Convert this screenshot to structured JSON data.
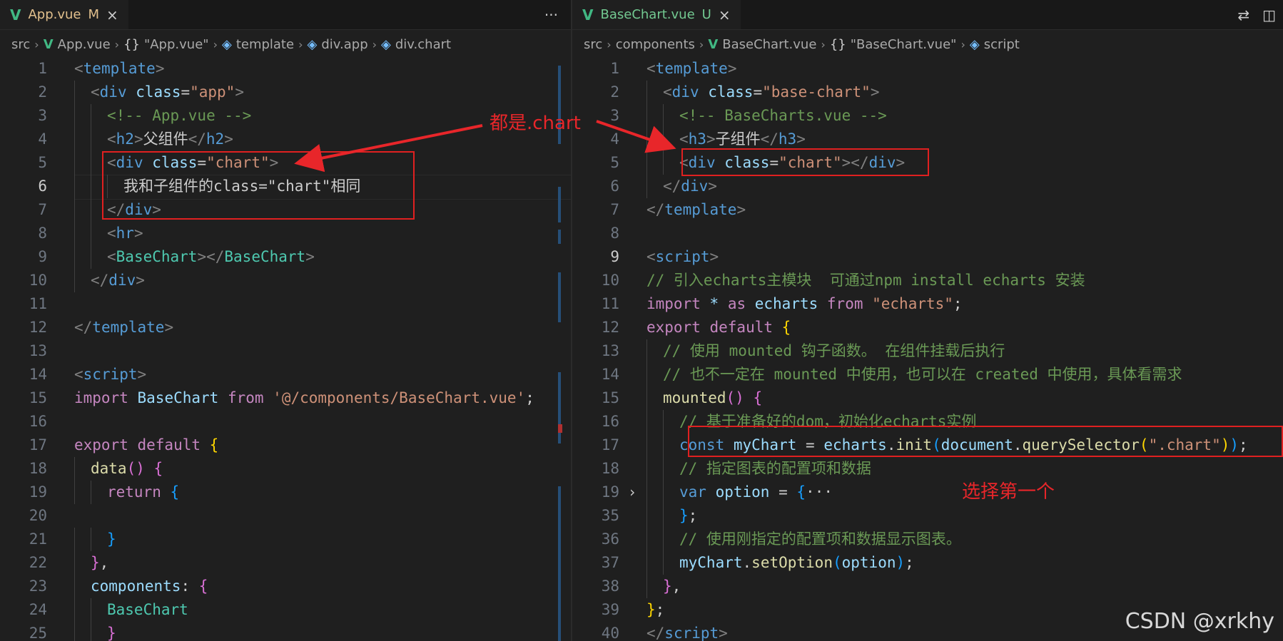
{
  "left": {
    "tab": {
      "name": "App.vue",
      "status": "M",
      "close": "×"
    },
    "more": "···",
    "breadcrumb": [
      "src",
      "App.vue",
      "\"App.vue\"",
      "template",
      "div.app",
      "div.chart"
    ],
    "lines": [
      {
        "n": "1",
        "tokens": [
          [
            "t-punc",
            "<"
          ],
          [
            "t-tag",
            "template"
          ],
          [
            "t-punc",
            ">"
          ]
        ],
        "indent": 0
      },
      {
        "n": "2",
        "tokens": [
          [
            "t-punc",
            "<"
          ],
          [
            "t-tag",
            "div "
          ],
          [
            "t-attr",
            "class"
          ],
          [
            "t-text",
            "="
          ],
          [
            "t-str",
            "\"app\""
          ],
          [
            "t-punc",
            ">"
          ]
        ],
        "indent": 1
      },
      {
        "n": "3",
        "tokens": [
          [
            "t-com",
            "<!-- App.vue -->"
          ]
        ],
        "indent": 2
      },
      {
        "n": "4",
        "tokens": [
          [
            "t-punc",
            "<"
          ],
          [
            "t-tag",
            "h2"
          ],
          [
            "t-punc",
            ">"
          ],
          [
            "t-text",
            "父组件"
          ],
          [
            "t-punc",
            "</"
          ],
          [
            "t-tag",
            "h2"
          ],
          [
            "t-punc",
            ">"
          ]
        ],
        "indent": 2
      },
      {
        "n": "5",
        "tokens": [
          [
            "t-punc",
            "<"
          ],
          [
            "t-tag",
            "div "
          ],
          [
            "t-attr",
            "class"
          ],
          [
            "t-text",
            "="
          ],
          [
            "t-str",
            "\"chart\""
          ],
          [
            "t-punc",
            ">"
          ]
        ],
        "indent": 2
      },
      {
        "n": "6",
        "tokens": [
          [
            "t-text",
            "我和子组件的class=\"chart\"相同"
          ]
        ],
        "indent": 3
      },
      {
        "n": "7",
        "tokens": [
          [
            "t-punc",
            "</"
          ],
          [
            "t-tag",
            "div"
          ],
          [
            "t-punc",
            ">"
          ]
        ],
        "indent": 2
      },
      {
        "n": "8",
        "tokens": [
          [
            "t-punc",
            "<"
          ],
          [
            "t-tag",
            "hr"
          ],
          [
            "t-punc",
            ">"
          ]
        ],
        "indent": 2
      },
      {
        "n": "9",
        "tokens": [
          [
            "t-punc",
            "<"
          ],
          [
            "t-comp",
            "BaseChart"
          ],
          [
            "t-punc",
            "></"
          ],
          [
            "t-comp",
            "BaseChart"
          ],
          [
            "t-punc",
            ">"
          ]
        ],
        "indent": 2
      },
      {
        "n": "10",
        "tokens": [
          [
            "t-punc",
            "</"
          ],
          [
            "t-tag",
            "div"
          ],
          [
            "t-punc",
            ">"
          ]
        ],
        "indent": 1
      },
      {
        "n": "11",
        "tokens": [],
        "indent": 0
      },
      {
        "n": "12",
        "tokens": [
          [
            "t-punc",
            "</"
          ],
          [
            "t-tag",
            "template"
          ],
          [
            "t-punc",
            ">"
          ]
        ],
        "indent": 0
      },
      {
        "n": "13",
        "tokens": [],
        "indent": 0
      },
      {
        "n": "14",
        "tokens": [
          [
            "t-punc",
            "<"
          ],
          [
            "t-tag",
            "script"
          ],
          [
            "t-punc",
            ">"
          ]
        ],
        "indent": 0
      },
      {
        "n": "15",
        "tokens": [
          [
            "t-kw",
            "import "
          ],
          [
            "t-var",
            "BaseChart "
          ],
          [
            "t-kw",
            "from "
          ],
          [
            "t-str",
            "'@/components/BaseChart.vue'"
          ],
          [
            "t-text",
            ";"
          ]
        ],
        "indent": 0
      },
      {
        "n": "16",
        "tokens": [],
        "indent": 0
      },
      {
        "n": "17",
        "tokens": [
          [
            "t-kw",
            "export default "
          ],
          [
            "t-br1",
            "{"
          ]
        ],
        "indent": 0
      },
      {
        "n": "18",
        "tokens": [
          [
            "t-fn",
            "data"
          ],
          [
            "t-br2",
            "()"
          ],
          [
            "t-text",
            " "
          ],
          [
            "t-br2",
            "{"
          ]
        ],
        "indent": 1
      },
      {
        "n": "19",
        "tokens": [
          [
            "t-kw",
            "return "
          ],
          [
            "t-br3",
            "{"
          ]
        ],
        "indent": 2
      },
      {
        "n": "20",
        "tokens": [],
        "indent": 0
      },
      {
        "n": "21",
        "tokens": [
          [
            "t-br3",
            "}"
          ]
        ],
        "indent": 2
      },
      {
        "n": "22",
        "tokens": [
          [
            "t-br2",
            "}"
          ],
          [
            "t-text",
            ","
          ]
        ],
        "indent": 1
      },
      {
        "n": "23",
        "tokens": [
          [
            "t-var",
            "components"
          ],
          [
            "t-text",
            ": "
          ],
          [
            "t-br2",
            "{"
          ]
        ],
        "indent": 1
      },
      {
        "n": "24",
        "tokens": [
          [
            "t-comp",
            "BaseChart"
          ]
        ],
        "indent": 2
      },
      {
        "n": "25",
        "tokens": [
          [
            "t-br2",
            "}"
          ]
        ],
        "indent": 2
      }
    ],
    "annotation": "都是.chart"
  },
  "right": {
    "tab": {
      "name": "BaseChart.vue",
      "status": "U",
      "close": "×"
    },
    "actions": [
      "⇄",
      "◫"
    ],
    "breadcrumb": [
      "src",
      "components",
      "BaseChart.vue",
      "\"BaseChart.vue\"",
      "script"
    ],
    "lines": [
      {
        "n": "1",
        "tokens": [
          [
            "t-punc",
            "<"
          ],
          [
            "t-tag",
            "template"
          ],
          [
            "t-punc",
            ">"
          ]
        ],
        "indent": 0
      },
      {
        "n": "2",
        "tokens": [
          [
            "t-punc",
            "<"
          ],
          [
            "t-tag",
            "div "
          ],
          [
            "t-attr",
            "class"
          ],
          [
            "t-text",
            "="
          ],
          [
            "t-str",
            "\"base-chart\""
          ],
          [
            "t-punc",
            ">"
          ]
        ],
        "indent": 1
      },
      {
        "n": "3",
        "tokens": [
          [
            "t-com",
            "<!-- BaseCharts.vue -->"
          ]
        ],
        "indent": 2
      },
      {
        "n": "4",
        "tokens": [
          [
            "t-punc",
            "<"
          ],
          [
            "t-tag",
            "h3"
          ],
          [
            "t-punc",
            ">"
          ],
          [
            "t-text",
            "子组件"
          ],
          [
            "t-punc",
            "</"
          ],
          [
            "t-tag",
            "h3"
          ],
          [
            "t-punc",
            ">"
          ]
        ],
        "indent": 2
      },
      {
        "n": "5",
        "tokens": [
          [
            "t-punc",
            "<"
          ],
          [
            "t-tag",
            "div "
          ],
          [
            "t-attr",
            "class"
          ],
          [
            "t-text",
            "="
          ],
          [
            "t-str",
            "\"chart\""
          ],
          [
            "t-punc",
            "></"
          ],
          [
            "t-tag",
            "div"
          ],
          [
            "t-punc",
            ">"
          ]
        ],
        "indent": 2
      },
      {
        "n": "6",
        "tokens": [
          [
            "t-punc",
            "</"
          ],
          [
            "t-tag",
            "div"
          ],
          [
            "t-punc",
            ">"
          ]
        ],
        "indent": 1
      },
      {
        "n": "7",
        "tokens": [
          [
            "t-punc",
            "</"
          ],
          [
            "t-tag",
            "template"
          ],
          [
            "t-punc",
            ">"
          ]
        ],
        "indent": 0
      },
      {
        "n": "8",
        "tokens": [],
        "indent": 0
      },
      {
        "n": "9",
        "tokens": [
          [
            "t-punc",
            "<"
          ],
          [
            "t-tag",
            "script"
          ],
          [
            "t-punc",
            ">"
          ]
        ],
        "indent": 0
      },
      {
        "n": "10",
        "tokens": [
          [
            "t-com",
            "// 引入echarts主模块  可通过npm install echarts 安装"
          ]
        ],
        "indent": 0
      },
      {
        "n": "11",
        "tokens": [
          [
            "t-kw",
            "import "
          ],
          [
            "t-var",
            "* "
          ],
          [
            "t-kw",
            "as "
          ],
          [
            "t-var",
            "echarts "
          ],
          [
            "t-kw",
            "from "
          ],
          [
            "t-str",
            "\"echarts\""
          ],
          [
            "t-text",
            ";"
          ]
        ],
        "indent": 0
      },
      {
        "n": "12",
        "tokens": [
          [
            "t-kw",
            "export default "
          ],
          [
            "t-br1",
            "{"
          ]
        ],
        "indent": 0
      },
      {
        "n": "13",
        "tokens": [
          [
            "t-com",
            "// 使用 mounted 钩子函数。 在组件挂载后执行"
          ]
        ],
        "indent": 1
      },
      {
        "n": "14",
        "tokens": [
          [
            "t-com",
            "// 也不一定在 mounted 中使用，也可以在 created 中使用，具体看需求"
          ]
        ],
        "indent": 1
      },
      {
        "n": "15",
        "tokens": [
          [
            "t-fn",
            "mounted"
          ],
          [
            "t-br2",
            "()"
          ],
          [
            "t-text",
            " "
          ],
          [
            "t-br2",
            "{"
          ]
        ],
        "indent": 1
      },
      {
        "n": "16",
        "tokens": [
          [
            "t-com",
            "// 基于准备好的dom，初始化echarts实例"
          ]
        ],
        "indent": 2
      },
      {
        "n": "17",
        "tokens": [
          [
            "t-storage",
            "const "
          ],
          [
            "t-var",
            "myChart "
          ],
          [
            "t-text",
            "= "
          ],
          [
            "t-var",
            "echarts"
          ],
          [
            "t-text",
            "."
          ],
          [
            "t-fn",
            "init"
          ],
          [
            "t-br3",
            "("
          ],
          [
            "t-var",
            "document"
          ],
          [
            "t-text",
            "."
          ],
          [
            "t-fn",
            "querySelector"
          ],
          [
            "t-br1",
            "("
          ],
          [
            "t-str",
            "\".chart\""
          ],
          [
            "t-br1",
            ")"
          ],
          [
            "t-br3",
            ")"
          ],
          [
            "t-text",
            ";"
          ]
        ],
        "indent": 2
      },
      {
        "n": "18",
        "tokens": [
          [
            "t-com",
            "// 指定图表的配置项和数据"
          ]
        ],
        "indent": 2
      },
      {
        "n": "19",
        "tokens": [
          [
            "t-storage",
            "var "
          ],
          [
            "t-var",
            "option "
          ],
          [
            "t-text",
            "= "
          ],
          [
            "t-br3",
            "{"
          ],
          [
            "t-text",
            "···"
          ]
        ],
        "indent": 2
      },
      {
        "n": "35",
        "tokens": [
          [
            "t-br3",
            "}"
          ],
          [
            "t-text",
            ";"
          ]
        ],
        "indent": 2
      },
      {
        "n": "36",
        "tokens": [
          [
            "t-com",
            "// 使用刚指定的配置项和数据显示图表。"
          ]
        ],
        "indent": 2
      },
      {
        "n": "37",
        "tokens": [
          [
            "t-var",
            "myChart"
          ],
          [
            "t-text",
            "."
          ],
          [
            "t-fn",
            "setOption"
          ],
          [
            "t-br3",
            "("
          ],
          [
            "t-var",
            "option"
          ],
          [
            "t-br3",
            ")"
          ],
          [
            "t-text",
            ";"
          ]
        ],
        "indent": 2
      },
      {
        "n": "38",
        "tokens": [
          [
            "t-br2",
            "}"
          ],
          [
            "t-text",
            ","
          ]
        ],
        "indent": 1
      },
      {
        "n": "39",
        "tokens": [
          [
            "t-br1",
            "}"
          ],
          [
            "t-text",
            ";"
          ]
        ],
        "indent": 0
      },
      {
        "n": "40",
        "tokens": [
          [
            "t-punc",
            "</"
          ],
          [
            "t-tag",
            "script"
          ],
          [
            "t-punc",
            ">"
          ]
        ],
        "indent": 0
      }
    ],
    "annotation": "选择第一个"
  },
  "watermark": "CSDN @xrkhy"
}
